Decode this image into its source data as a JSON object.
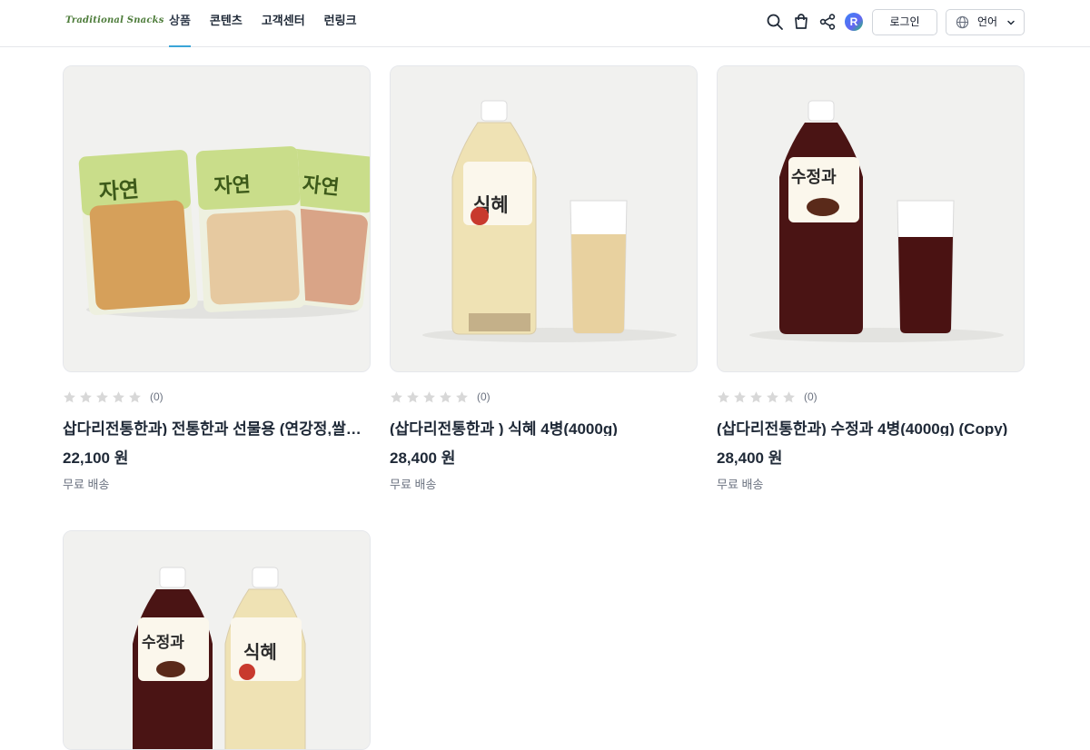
{
  "header": {
    "logo_text": "Traditional Snacks",
    "nav": [
      {
        "label": "상품",
        "active": true
      },
      {
        "label": "콘텐츠"
      },
      {
        "label": "고객센터"
      },
      {
        "label": "런링크"
      }
    ],
    "icons": [
      "search-icon",
      "cart-icon",
      "share-icon",
      "profile-avatar"
    ],
    "avatar_letter": "R",
    "login_label": "로그인",
    "language_label": "언어",
    "accent_color": "#3aa5d8"
  },
  "products": [
    {
      "rating_count": "(0)",
      "title": "삽다리전통한과) 전통한과 선물용 (연강정,쌀강정,깨강정)",
      "price": "22,100 원",
      "shipping": "무료 배송",
      "image": "rice-cracker-bags"
    },
    {
      "rating_count": "(0)",
      "title": "(삽다리전통한과 ) 식혜 4병(4000g)",
      "price": "28,400 원",
      "shipping": "무료 배송",
      "image": "sikhye-bottle-and-glass",
      "bottle_label": "식혜"
    },
    {
      "rating_count": "(0)",
      "title": "(삽다리전통한과) 수정과 4병(4000g) (Copy)",
      "price": "28,400 원",
      "shipping": "무료 배송",
      "image": "sujeonggwa-bottle-and-glass",
      "bottle_label": "수정과"
    },
    {
      "image": "sujeonggwa-and-sikhye-bottles",
      "bottle_labels": [
        "수정과",
        "식혜"
      ]
    }
  ],
  "bag_label": "자연"
}
